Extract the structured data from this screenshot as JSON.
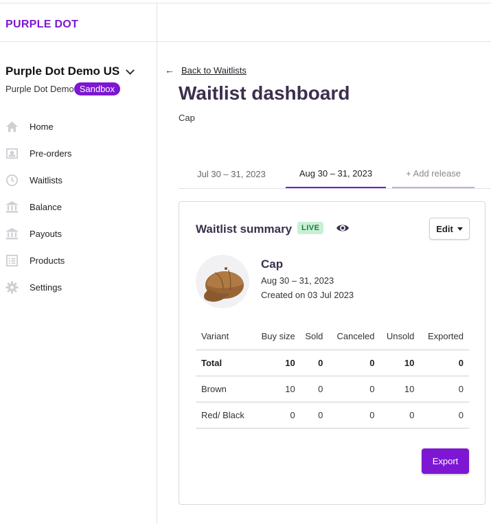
{
  "brand": "PURPLE DOT",
  "store": {
    "name": "Purple Dot Demo US",
    "subtitle": "Purple Dot Demo",
    "badge": "Sandbox"
  },
  "nav": [
    {
      "label": "Home",
      "icon": "home-icon"
    },
    {
      "label": "Pre-orders",
      "icon": "preorders-icon"
    },
    {
      "label": "Waitlists",
      "icon": "clock-icon"
    },
    {
      "label": "Balance",
      "icon": "bank-icon"
    },
    {
      "label": "Payouts",
      "icon": "bank-icon"
    },
    {
      "label": "Products",
      "icon": "list-icon"
    },
    {
      "label": "Settings",
      "icon": "gear-icon"
    }
  ],
  "back_link": "Back to Waitlists",
  "page_title": "Waitlist dashboard",
  "page_subtitle": "Cap",
  "tabs": [
    {
      "label": "Jul 30 – 31, 2023"
    },
    {
      "label": "Aug 30 – 31, 2023"
    },
    {
      "label": "+ Add release"
    }
  ],
  "summary": {
    "title": "Waitlist summary",
    "status": "LIVE",
    "edit_label": "Edit",
    "product": {
      "name": "Cap",
      "dates": "Aug 30 – 31, 2023",
      "created": "Created on 03 Jul 2023"
    },
    "table": {
      "headers": [
        "Variant",
        "Buy size",
        "Sold",
        "Canceled",
        "Unsold",
        "Exported"
      ],
      "rows": [
        [
          "Total",
          "10",
          "0",
          "0",
          "10",
          "0"
        ],
        [
          "Brown",
          "10",
          "0",
          "0",
          "10",
          "0"
        ],
        [
          "Red/ Black",
          "0",
          "0",
          "0",
          "0",
          "0"
        ]
      ]
    },
    "export_label": "Export"
  },
  "colors": {
    "accent": "#7d17d3",
    "title": "#3b2f4d",
    "live_bg": "#c9f0d4",
    "live_text": "#1c7a3a"
  }
}
